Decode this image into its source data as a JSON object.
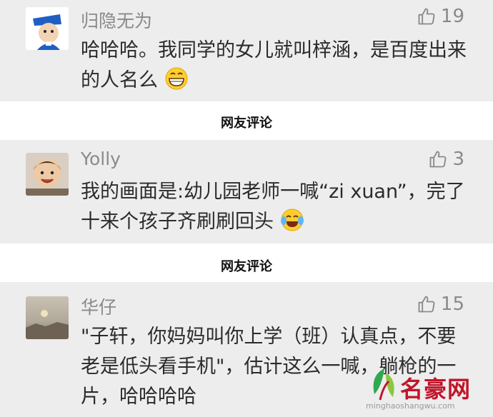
{
  "comments": [
    {
      "username": "归隐无为",
      "likes": "19",
      "text": "哈哈哈。我同学的女儿就叫梓涵，是百度出来的人名么"
    },
    {
      "username": "Yolly",
      "likes": "3",
      "text": "我的画面是:幼儿园老师一喊“zi xuan”，完了十来个孩子齐刷刷回头"
    },
    {
      "username": "华仔",
      "likes": "15",
      "text": "\"子轩，你妈妈叫你上学（班）认真点，不要老是低头看手机\"，估计这么一喊，躺枪的一片，哈哈哈哈"
    }
  ],
  "section_labels": [
    "网友评论",
    "网友评论"
  ],
  "watermark": {
    "title": "名豪网",
    "url": "minghaoshangwu.com"
  },
  "colors": {
    "card_bg": "#ededed",
    "meta_gray": "#8a8a8a",
    "text": "#2b2b2b",
    "watermark_red": "#c0152a"
  },
  "icons": {
    "like": "thumbs-up-icon",
    "emoji_grin": "grinning-emoji-icon",
    "emoji_tears": "tears-of-joy-emoji-icon"
  }
}
